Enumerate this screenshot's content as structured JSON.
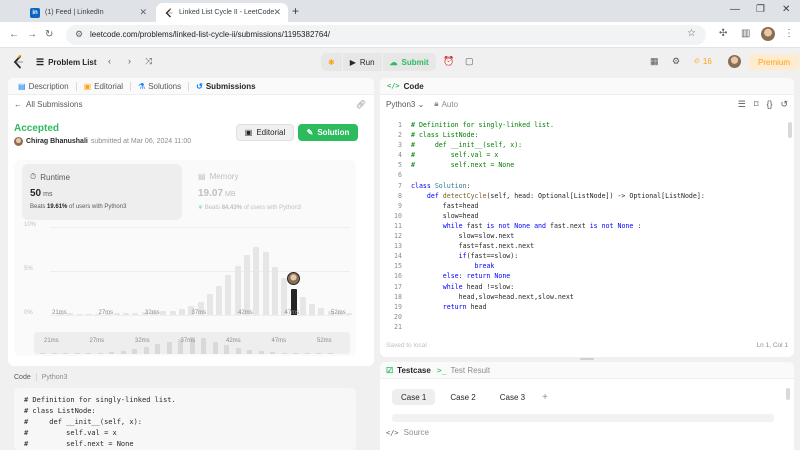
{
  "browser": {
    "tabs": [
      {
        "title": "(1) Feed | LinkedIn",
        "favicon": "in"
      },
      {
        "title": "Linked List Cycle II - LeetCode",
        "favicon": "leetcode"
      }
    ],
    "url": "leetcode.com/problems/linked-list-cycle-ii/submissions/1195382764/"
  },
  "nav": {
    "problem_list": "Problem List",
    "run": "Run",
    "submit": "Submit",
    "streak": "16",
    "premium": "Premium"
  },
  "left": {
    "tabs": [
      "Description",
      "Editorial",
      "Solutions",
      "Submissions"
    ],
    "all_submissions": "All Submissions",
    "status": "Accepted",
    "author": "Chirag Bhanushali",
    "submitted_at": "submitted at Mar 06, 2024 11:00",
    "editorial_btn": "Editorial",
    "solution_btn": "Solution",
    "runtime": {
      "label": "Runtime",
      "value": "50",
      "unit": "ms",
      "beats_prefix": "Beats",
      "beats": "19.61%",
      "beats_suffix": "of users with Python3"
    },
    "memory": {
      "label": "Memory",
      "value": "19.07",
      "unit": "MB",
      "beats_prefix": "Beats",
      "beats": "84.43%",
      "beats_suffix": "of users with Python3"
    },
    "code_label": "Code",
    "code_lang": "Python3",
    "code_preview": [
      "# Definition for singly-linked list.",
      "# class ListNode:",
      "#     def __init__(self, x):",
      "#         self.val = x",
      "#         self.next = None"
    ]
  },
  "chart_data": {
    "type": "bar",
    "y_ticks": [
      "10%",
      "5%",
      "0%"
    ],
    "ylim": [
      0,
      10
    ],
    "x_labels": [
      "21ms",
      "27ms",
      "32ms",
      "37ms",
      "42ms",
      "47ms",
      "52ms"
    ],
    "values": [
      0.2,
      0.2,
      0.1,
      0.1,
      0.1,
      0.2,
      0.2,
      0.2,
      0.2,
      0.3,
      0.3,
      0.4,
      0.5,
      0.7,
      1,
      1.5,
      2.4,
      3.3,
      4.5,
      5.6,
      6.8,
      7.7,
      7.2,
      5.4,
      4.2,
      2.9,
      2,
      1.3,
      0.8,
      0.5,
      0.3,
      0.2
    ],
    "highlight_index": 25,
    "minimap_values": [
      0.2,
      0.1,
      0.2,
      0.2,
      0.3,
      0.5,
      0.8,
      1.4,
      2.4,
      3.3,
      4.5,
      5.6,
      6.8,
      7.7,
      7.2,
      5.4,
      4.2,
      2.9,
      2,
      1.3,
      0.8,
      0.5,
      0.3,
      0.2,
      0.2,
      0.1
    ],
    "minimap_labels": [
      "21ms",
      "27ms",
      "32ms",
      "37ms",
      "42ms",
      "47ms",
      "52ms"
    ]
  },
  "right": {
    "tab": "Code",
    "lang": "Python3",
    "auto": "Auto",
    "saved": "Saved to local",
    "cursor": "Ln 1, Col 1",
    "code_lines": [
      [
        [
          "cm",
          "# Definition for singly-linked list."
        ]
      ],
      [
        [
          "cm",
          "# class ListNode:"
        ]
      ],
      [
        [
          "cm",
          "#     def __init__(self, x):"
        ]
      ],
      [
        [
          "cm",
          "#         self.val = x"
        ]
      ],
      [
        [
          "cm",
          "#         self.next = None"
        ]
      ],
      [
        [
          "tx",
          ""
        ]
      ],
      [
        [
          "kw",
          "class "
        ],
        [
          "cl",
          "Solution"
        ],
        [
          "tx",
          ":"
        ]
      ],
      [
        [
          "tx",
          "    "
        ],
        [
          "kw",
          "def "
        ],
        [
          "fn",
          "detectCycle"
        ],
        [
          "tx",
          "(self, head: Optional[ListNode]) -> Optional[ListNode]:"
        ]
      ],
      [
        [
          "tx",
          "        fast=head"
        ]
      ],
      [
        [
          "tx",
          "        slow=head"
        ]
      ],
      [
        [
          "tx",
          "        "
        ],
        [
          "kw",
          "while "
        ],
        [
          "tx",
          "fast "
        ],
        [
          "kw",
          "is not None and "
        ],
        [
          "tx",
          "fast.next "
        ],
        [
          "kw",
          "is not None "
        ],
        [
          "tx",
          ":"
        ]
      ],
      [
        [
          "tx",
          "            slow=slow.next"
        ]
      ],
      [
        [
          "tx",
          "            fast=fast.next.next"
        ]
      ],
      [
        [
          "tx",
          "            "
        ],
        [
          "kw",
          "if"
        ],
        [
          "tx",
          "(fast==slow):"
        ]
      ],
      [
        [
          "tx",
          "                "
        ],
        [
          "kw",
          "break"
        ]
      ],
      [
        [
          "tx",
          "        "
        ],
        [
          "kw",
          "else"
        ],
        [
          "tx",
          ": "
        ],
        [
          "kw",
          "return None"
        ]
      ],
      [
        [
          "tx",
          "        "
        ],
        [
          "kw",
          "while "
        ],
        [
          "tx",
          "head !=slow:"
        ]
      ],
      [
        [
          "tx",
          "            head,slow=head.next,slow.next"
        ]
      ],
      [
        [
          "tx",
          "        "
        ],
        [
          "kw",
          "return "
        ],
        [
          "tx",
          "head"
        ]
      ],
      [
        [
          "tx",
          ""
        ]
      ],
      [
        [
          "tx",
          ""
        ]
      ]
    ],
    "testcase_tab": "Testcase",
    "result_tab": "Test Result",
    "cases": [
      "Case 1",
      "Case 2",
      "Case 3"
    ],
    "source": "Source"
  }
}
